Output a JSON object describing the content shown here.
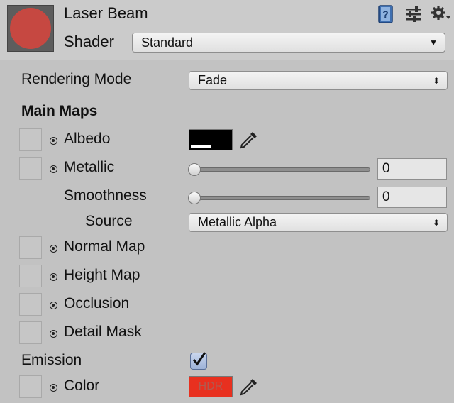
{
  "header": {
    "title": "Laser Beam",
    "shader_label": "Shader",
    "shader_value": "Standard",
    "preview_color": "#c64841",
    "icons": [
      "help-book-icon",
      "preset-sliders-icon",
      "settings-gear-icon"
    ]
  },
  "rendering": {
    "label": "Rendering Mode",
    "value": "Fade"
  },
  "main_maps": {
    "heading": "Main Maps",
    "albedo": {
      "label": "Albedo",
      "color": "#000000"
    },
    "metallic": {
      "label": "Metallic",
      "value": "0"
    },
    "smoothness": {
      "label": "Smoothness",
      "value": "0"
    },
    "source": {
      "label": "Source",
      "value": "Metallic Alpha"
    },
    "normal_map": {
      "label": "Normal Map"
    },
    "height_map": {
      "label": "Height Map"
    },
    "occlusion": {
      "label": "Occlusion"
    },
    "detail_mask": {
      "label": "Detail Mask"
    }
  },
  "emission": {
    "label": "Emission",
    "checked": true,
    "color_label": "Color",
    "color_hdr_text": "HDR",
    "color": "#e8301f"
  }
}
